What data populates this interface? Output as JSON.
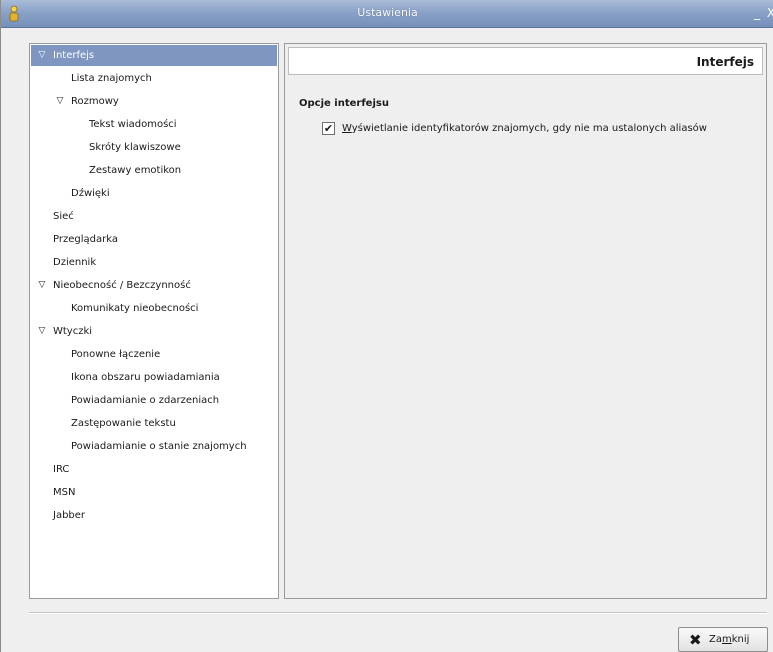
{
  "window": {
    "title": "Ustawienia",
    "minimize_glyph": "_",
    "close_glyph": "X",
    "icon": "gaim-person-icon"
  },
  "tree": {
    "items": [
      {
        "label": "Interfejs",
        "level": 0,
        "expanded": true,
        "selected": true
      },
      {
        "label": "Lista znajomych",
        "level": 1,
        "expanded": null,
        "selected": false
      },
      {
        "label": "Rozmowy",
        "level": 1,
        "expanded": true,
        "selected": false
      },
      {
        "label": "Tekst wiadomości",
        "level": 2,
        "expanded": null,
        "selected": false
      },
      {
        "label": "Skróty klawiszowe",
        "level": 2,
        "expanded": null,
        "selected": false
      },
      {
        "label": "Zestawy emotikon",
        "level": 2,
        "expanded": null,
        "selected": false
      },
      {
        "label": "Dźwięki",
        "level": 1,
        "expanded": null,
        "selected": false
      },
      {
        "label": "Sieć",
        "level": 0,
        "expanded": null,
        "selected": false
      },
      {
        "label": "Przeglądarka",
        "level": 0,
        "expanded": null,
        "selected": false
      },
      {
        "label": "Dziennik",
        "level": 0,
        "expanded": null,
        "selected": false
      },
      {
        "label": "Nieobecność / Bezczynność",
        "level": 0,
        "expanded": true,
        "selected": false
      },
      {
        "label": "Komunikaty nieobecności",
        "level": 1,
        "expanded": null,
        "selected": false
      },
      {
        "label": "Wtyczki",
        "level": 0,
        "expanded": true,
        "selected": false
      },
      {
        "label": "Ponowne łączenie",
        "level": 1,
        "expanded": null,
        "selected": false
      },
      {
        "label": "Ikona obszaru powiadamiania",
        "level": 1,
        "expanded": null,
        "selected": false
      },
      {
        "label": "Powiadamianie o zdarzeniach",
        "level": 1,
        "expanded": null,
        "selected": false
      },
      {
        "label": "Zastępowanie tekstu",
        "level": 1,
        "expanded": null,
        "selected": false
      },
      {
        "label": "Powiadamianie o stanie znajomych",
        "level": 1,
        "expanded": null,
        "selected": false
      },
      {
        "label": "IRC",
        "level": 0,
        "expanded": null,
        "selected": false
      },
      {
        "label": "MSN",
        "level": 0,
        "expanded": null,
        "selected": false
      },
      {
        "label": "Jabber",
        "level": 0,
        "expanded": null,
        "selected": false
      }
    ],
    "expander_icon": "triangle-down-icon"
  },
  "pane": {
    "title": "Interfejs",
    "section_title": "Opcje interfejsu",
    "options": [
      {
        "mnemonic": "W",
        "label_rest": "yświetlanie identyfikatorów znajomych, gdy nie ma ustalonych aliasów",
        "checked": true,
        "check_glyph": "✔"
      }
    ]
  },
  "buttons": {
    "close": {
      "icon_glyph": "✖",
      "label_before": "Za",
      "mnemonic": "m",
      "label_after": "knij"
    }
  },
  "colors": {
    "titlebar": "#8aa2c7",
    "selection": "#7f96c1",
    "background": "#efefef"
  }
}
